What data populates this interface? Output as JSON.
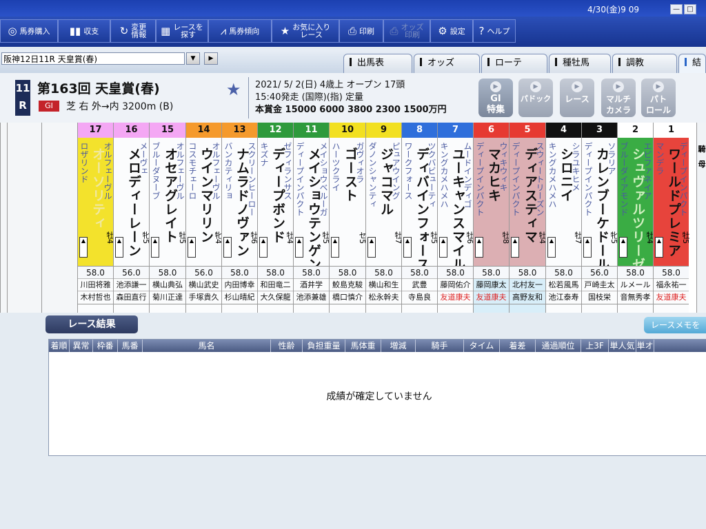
{
  "titlebar": {
    "datetime": "4/30(金)9 09"
  },
  "toolbar": {
    "buttons": [
      {
        "label": "馬券購入"
      },
      {
        "label": "収支"
      },
      {
        "label": "変更\n情報"
      },
      {
        "label": "レースを\n探す"
      },
      {
        "label": "馬券傾向"
      },
      {
        "label": "お気に入り\nレース"
      },
      {
        "label": "印刷"
      },
      {
        "label": "オッズ\n印刷"
      },
      {
        "label": "設定"
      },
      {
        "label": "ヘルプ"
      }
    ]
  },
  "race_selector": {
    "value": "阪神12日11R 天皇賞(春)"
  },
  "tabs": [
    "出馬表",
    "オッズ",
    "ローテ",
    "種牡馬",
    "調教",
    "結"
  ],
  "race": {
    "number_top": "11",
    "number_bottom": "R",
    "title": "第163回 天皇賞(春)",
    "grade": "GI",
    "course": "芝 右 外→内 3200m (B)",
    "date_line": "2021/ 5/ 2(日) 4歳上 オープン 17頭",
    "start_line": "15:40発走 (国際)(指) 定量",
    "prize_line": "本賞金 15000 6000 3800 2300 1500万円"
  },
  "video_buttons": [
    {
      "label": "GI\n特集"
    },
    {
      "label": "パドック"
    },
    {
      "label": "レース"
    },
    {
      "label": "マルチ\nカメラ"
    },
    {
      "label": "パト\nロール"
    }
  ],
  "bracket_headers": [
    "17 ⑧ 16 ⑧ 15",
    "14 ⑦ 13",
    "12 ⑥ 11",
    "10 ⑤ 9",
    "8 ④ 7",
    "6 ③ 5",
    "4 ② 3",
    "2 ① 1"
  ],
  "horses": [
    {
      "num": "17",
      "sire": "オルフェーヴル",
      "name": "オーソリティ",
      "dam": "ロザリンド",
      "sex": "牡4",
      "weight": "58.0",
      "jockey": "川田将雅",
      "trainer": "木村哲也",
      "trainer_red": false
    },
    {
      "num": "16",
      "sire": "メーヴェ",
      "name": "メロディーレーン",
      "dam": "",
      "sex": "牝5",
      "weight": "56.0",
      "jockey": "池添謙一",
      "trainer": "森田直行",
      "trainer_red": false
    },
    {
      "num": "15",
      "sire": "オルフェーヴル",
      "name": "オセアグレイト",
      "dam": "ブルーダヌーブ",
      "sex": "牡5",
      "weight": "58.0",
      "jockey": "横山典弘",
      "trainer": "菊川正達",
      "trainer_red": false
    },
    {
      "num": "14",
      "sire": "オルフェーヴル",
      "name": "ウインマリリン",
      "dam": "コスモチェーロ",
      "sex": "牝4",
      "weight": "56.0",
      "jockey": "横山武史",
      "trainer": "手塚貴久",
      "trainer_red": false
    },
    {
      "num": "13",
      "sire": "スクリーンヒーロー",
      "name": "ナムラドノヴァン",
      "dam": "バンカティリョ",
      "sex": "牡6",
      "weight": "58.0",
      "jockey": "内田博幸",
      "trainer": "杉山晴紀",
      "trainer_red": false
    },
    {
      "num": "12",
      "sire": "ゼフィランサス",
      "name": "ディープボンド",
      "dam": "キズナ",
      "sex": "牡4",
      "weight": "58.0",
      "jockey": "和田竜二",
      "trainer": "大久保龍",
      "trainer_red": false
    },
    {
      "num": "11",
      "sire": "メイショウベルーガ",
      "name": "メイショウテンゲン",
      "dam": "ディープインパクト",
      "sex": "牡5",
      "weight": "58.0",
      "jockey": "酒井学",
      "trainer": "池添兼雄",
      "trainer_red": false
    },
    {
      "num": "10",
      "sire": "ガヴィオラ",
      "name": "ゴースト",
      "dam": "ハーツクライ",
      "sex": "セ5",
      "weight": "58.0",
      "jockey": "鮫島克駿",
      "trainer": "橋口慎介",
      "trainer_red": false
    },
    {
      "num": "9",
      "sire": "ピュアウイング",
      "name": "ジャコマル",
      "dam": "ダノンシャンティ",
      "sex": "牡7",
      "weight": "58.0",
      "jockey": "横山和生",
      "trainer": "松永幹夫",
      "trainer_red": false
    },
    {
      "num": "8",
      "sire": "ツクバビューティ",
      "name": "ディバインフォース",
      "dam": "ワークフォース",
      "sex": "牡5",
      "weight": "58.0",
      "jockey": "武豊",
      "trainer": "寺島良",
      "trainer_red": false
    },
    {
      "num": "7",
      "sire": "ムードインディゴ",
      "name": "ユーキャンスマイル",
      "dam": "キングカメハメハ",
      "sex": "牡6",
      "weight": "58.0",
      "jockey": "藤岡佑介",
      "trainer": "友道康夫",
      "trainer_red": true
    },
    {
      "num": "6",
      "sire": "ウィキウィキ",
      "name": "マカヒキ",
      "dam": "ディープインパクト",
      "sex": "牡8",
      "weight": "58.0",
      "jockey": "藤岡康太",
      "trainer": "友道康夫",
      "trainer_red": true
    },
    {
      "num": "5",
      "sire": "スウィートリーズン",
      "name": "ディアスティマ",
      "dam": "ディープインパクト",
      "sex": "牡4",
      "weight": "58.0",
      "jockey": "北村友一",
      "trainer": "高野友和",
      "trainer_red": false
    },
    {
      "num": "4",
      "sire": "シラユキヒメ",
      "name": "シロニイ",
      "dam": "キングカメハメハ",
      "sex": "牡7",
      "weight": "58.0",
      "jockey": "松若風馬",
      "trainer": "池江泰寿",
      "trainer_red": false
    },
    {
      "num": "3",
      "sire": "ソラリア",
      "name": "カレンブーケドール",
      "dam": "ディープインパクト",
      "sex": "牝5",
      "weight": "56.0",
      "jockey": "戸崎圭太",
      "trainer": "国枝栄",
      "trainer_red": false
    },
    {
      "num": "2",
      "sire": "エピファネイア",
      "name": "シュヴァルツリーゼ",
      "dam": "ブルーダイアモンド",
      "sex": "牡4",
      "weight": "58.0",
      "jockey": "ルメール",
      "trainer": "音無秀孝",
      "trainer_red": false
    },
    {
      "num": "1",
      "sire": "ディープインパクト",
      "name": "ワールドプレミア",
      "dam": "マンデラ",
      "sex": "牡5",
      "weight": "58.0",
      "jockey": "福永祐一",
      "trainer": "友道康夫",
      "trainer_red": true
    }
  ],
  "right_labels": [
    "騎",
    "母"
  ],
  "results": {
    "header": "レース結果",
    "memo_button": "レースメモを",
    "columns": [
      "着順",
      "異常",
      "枠番",
      "馬番",
      "馬名",
      "性齢",
      "負担重量",
      "馬体重",
      "増減",
      "騎手",
      "タイム",
      "着差",
      "通過順位",
      "上3F",
      "単人気",
      "単オ"
    ],
    "empty_message": "成績が確定していません"
  },
  "colors": {
    "bracket": [
      "#f2e021",
      "#f2e021",
      "#f2e021",
      "#f59a2c",
      "#f59a2c",
      "#2e9a3c",
      "#2e9a3c",
      "#f2e021",
      "#f2e021",
      "#2f6fdb",
      "#2f6fdb",
      "#e63a32",
      "#e63a32",
      "#111111",
      "#111111",
      "#2fa83a",
      "#e63a32"
    ],
    "header_bg": [
      "#f4a7f4",
      "#f4a7f4",
      "#f4a7f4",
      "#f59a2c",
      "#f59a2c",
      "#2e9a3c",
      "#2e9a3c",
      "#f2e021",
      "#f2e021",
      "#2f6fdb",
      "#2f6fdb",
      "#e63a32",
      "#e63a32",
      "#111111",
      "#111111",
      "#ffffff",
      "#ffffff"
    ]
  }
}
